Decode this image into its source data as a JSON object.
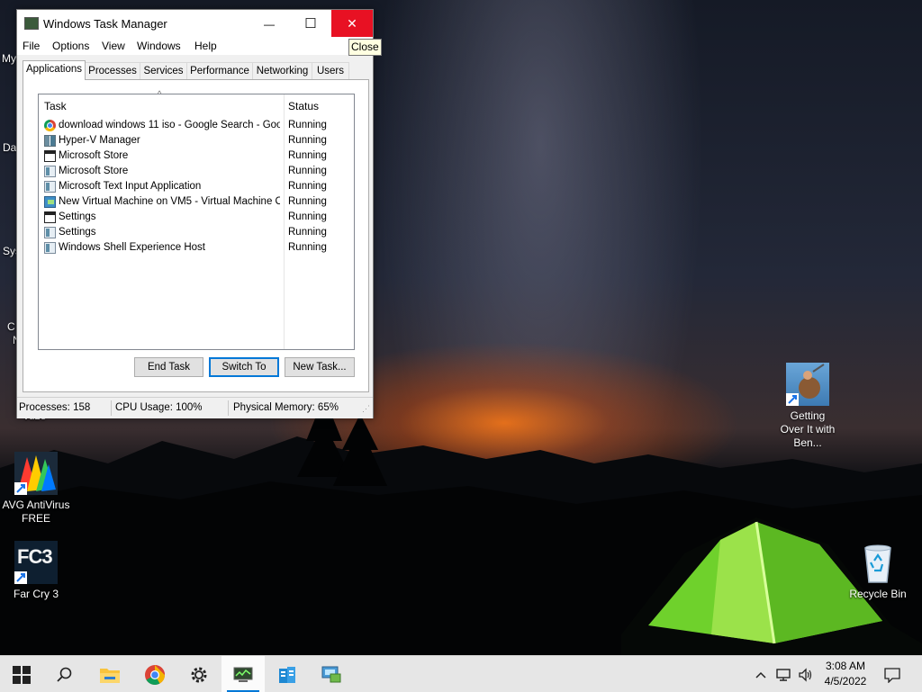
{
  "window": {
    "title": "Windows Task Manager",
    "minimize_glyph": "—",
    "maximize_glyph": "☐",
    "close_glyph": "✕",
    "tooltip": "Close"
  },
  "menu": [
    "File",
    "Options",
    "View",
    "Windows",
    "Help"
  ],
  "tabs": [
    {
      "label": "Applications",
      "active": true
    },
    {
      "label": "Processes"
    },
    {
      "label": "Services"
    },
    {
      "label": "Performance"
    },
    {
      "label": "Networking"
    },
    {
      "label": "Users"
    }
  ],
  "applications": {
    "columns": {
      "task": "Task",
      "status": "Status"
    },
    "rows": [
      {
        "task": "download windows 11 iso - Google Search - Goo...",
        "status": "Running",
        "icon": "chrome-icon"
      },
      {
        "task": "Hyper-V Manager",
        "status": "Running",
        "icon": "hyperv-icon"
      },
      {
        "task": "Microsoft Store",
        "status": "Running",
        "icon": "window-icon"
      },
      {
        "task": "Microsoft Store",
        "status": "Running",
        "icon": "app-icon"
      },
      {
        "task": "Microsoft Text Input Application",
        "status": "Running",
        "icon": "app-icon"
      },
      {
        "task": "New Virtual Machine on VM5 - Virtual Machine Co...",
        "status": "Running",
        "icon": "vm-icon"
      },
      {
        "task": "Settings",
        "status": "Running",
        "icon": "window-icon"
      },
      {
        "task": "Settings",
        "status": "Running",
        "icon": "app-icon"
      },
      {
        "task": "Windows Shell Experience Host",
        "status": "Running",
        "icon": "app-icon"
      }
    ],
    "buttons": {
      "end_task": "End Task",
      "switch_to": "Switch To",
      "new_task": "New Task..."
    }
  },
  "status_bar": {
    "processes": "Processes: 158",
    "cpu": "CPU Usage: 100%",
    "memory": "Physical Memory: 65%"
  },
  "desktop": {
    "icons": {
      "avg": "AVG AntiVirus FREE",
      "farcry": "Far Cry 3",
      "farcry_logo": "FC3",
      "getting_over": "Getting Over It with Ben...",
      "recycle": "Recycle Bin"
    },
    "left_fragments": [
      "My",
      "Da",
      "Sys",
      "C",
      "N",
      "vuze"
    ]
  },
  "taskbar": {
    "clock_time": "3:08 AM",
    "clock_date": "4/5/2022"
  }
}
